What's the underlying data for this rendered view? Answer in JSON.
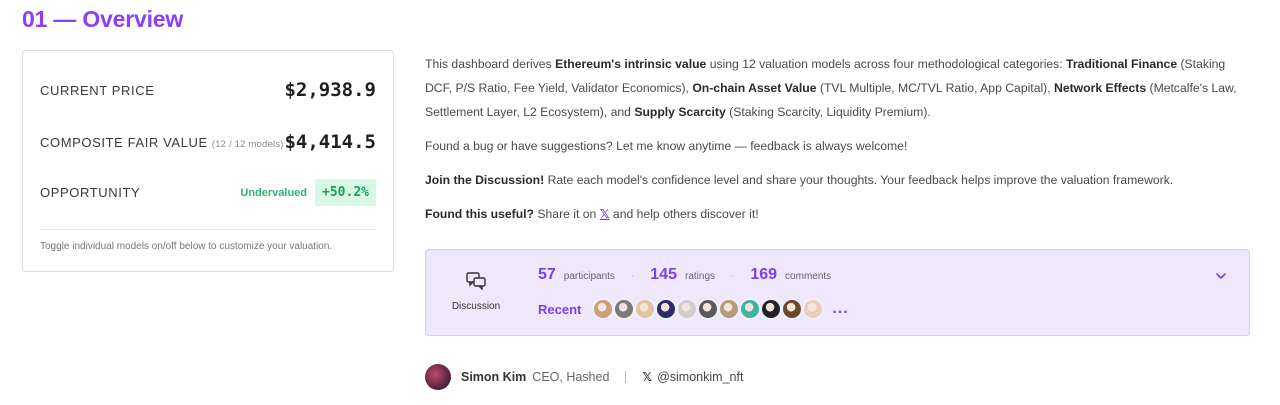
{
  "heading": "01 — Overview",
  "card": {
    "current_price_label": "CURRENT PRICE",
    "current_price_value": "$2,938.9",
    "fair_value_label": "COMPOSITE FAIR VALUE",
    "fair_value_sub": "(12 / 12 models)",
    "fair_value_value": "$4,414.5",
    "opportunity_label": "OPPORTUNITY",
    "opportunity_status": "Undervalued",
    "opportunity_pct": "+50.2%",
    "hint": "Toggle individual models on/off below to customize your valuation."
  },
  "desc": {
    "p1_a": "This dashboard derives ",
    "p1_b": "Ethereum's intrinsic value",
    "p1_c": " using 12 valuation models across four methodological categories: ",
    "p1_d": "Traditional Finance",
    "p1_e": " (Staking DCF, P/S Ratio, Fee Yield, Validator Economics), ",
    "p1_f": "On-chain Asset Value",
    "p1_g": " (TVL Multiple, MC/TVL Ratio, App Capital), ",
    "p1_h": "Network Effects",
    "p1_i": " (Metcalfe's Law, Settlement Layer, L2 Ecosystem), and ",
    "p1_j": "Supply Scarcity",
    "p1_k": " (Staking Scarcity, Liquidity Premium).",
    "p2": "Found a bug or have suggestions? Let me know anytime — feedback is always welcome!",
    "p3_a": "Join the Discussion!",
    "p3_b": " Rate each model's confidence level and share your thoughts. Your feedback helps improve the valuation framework.",
    "p4_a": "Found this useful?",
    "p4_b": " Share it on ",
    "p4_link": "𝕏",
    "p4_c": " and help others discover it!"
  },
  "discussion": {
    "label": "Discussion",
    "participants_num": "57",
    "participants_lbl": "participants",
    "ratings_num": "145",
    "ratings_lbl": "ratings",
    "comments_num": "169",
    "comments_lbl": "comments",
    "recent_label": "Recent",
    "more": "...",
    "avatar_colors": [
      "#c9a27a",
      "#7a7a7a",
      "#e0c3a0",
      "#2b2b6b",
      "#cfcfcf",
      "#5a5a5a",
      "#b89a7a",
      "#3fb3a0",
      "#222222",
      "#6b4a2a",
      "#e8d0c0"
    ]
  },
  "author": {
    "name": "Simon Kim",
    "role": "CEO, Hashed",
    "handle": "@simonkim_nft"
  },
  "colors": {
    "accent": "#8a3ffc",
    "success": "#2bb673",
    "panel_bg": "#efe8fb"
  }
}
